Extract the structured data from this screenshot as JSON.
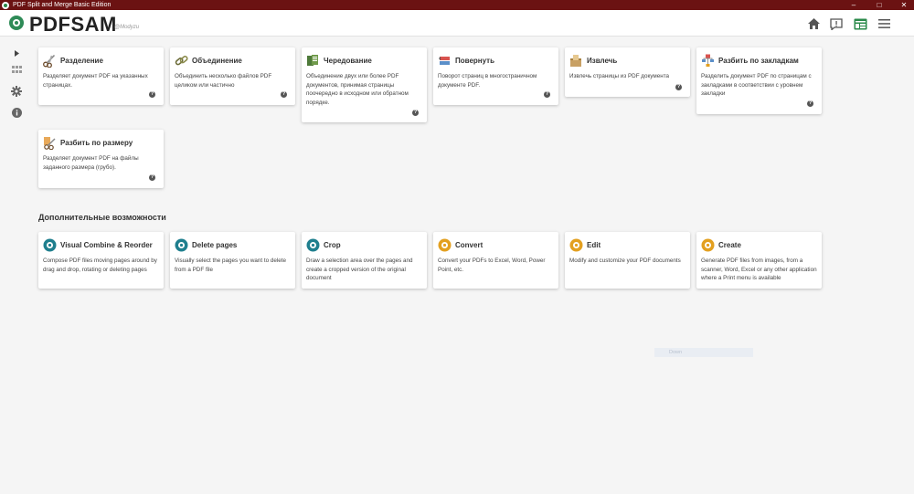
{
  "window": {
    "title": "PDF Split and Merge Basic Edition",
    "minimize": "–",
    "maximize": "□",
    "close": "✕"
  },
  "header": {
    "logo": "PDFSAM",
    "sublogo": "@Modyzu"
  },
  "tools": [
    {
      "title": "Разделение",
      "desc": "Разделяет документ PDF на указанных страницах.",
      "help": "?"
    },
    {
      "title": "Объединение",
      "desc": "Объединить несколько файлов PDF целиком или частично",
      "help": "?"
    },
    {
      "title": "Чередование",
      "desc": "Объединение двух или более PDF документов, принимая страницы поочередно в исходном или обратном порядке.",
      "help": "?"
    },
    {
      "title": "Повернуть",
      "desc": "Поворот страниц в многостраничном документе PDF.",
      "help": "?"
    },
    {
      "title": "Извлечь",
      "desc": "Извлечь страницы из PDF документа",
      "help": "?"
    },
    {
      "title": "Разбить по закладкам",
      "desc": "Разделить документ PDF по страницам с закладками в соответствии с уровнем закладки",
      "help": "?"
    },
    {
      "title": "Разбить по размеру",
      "desc": "Разделяет документ PDF на файлы заданного размера (грубо).",
      "help": "?"
    }
  ],
  "extras_title": "Дополнительные возможности",
  "extras": [
    {
      "title": "Visual Combine & Reorder",
      "desc": "Compose PDF files moving pages around by drag and drop, rotating or deleting pages"
    },
    {
      "title": "Delete pages",
      "desc": "Visually select the pages you want to delete from a PDF file"
    },
    {
      "title": "Crop",
      "desc": "Draw a selection area over the pages and create a cropped version of the original document"
    },
    {
      "title": "Convert",
      "desc": "Convert your PDFs to Excel, Word, Power Point, etc."
    },
    {
      "title": "Edit",
      "desc": "Modify and customize your PDF documents"
    },
    {
      "title": "Create",
      "desc": "Generate PDF files from images, from a scanner, Word, Excel or any other application where a Print menu is available"
    }
  ],
  "ghost_label": "Down",
  "colors": {
    "titlebar": "#6b1212",
    "brand_green": "#2e8b57",
    "teal_icon": "#1f7f8e",
    "orange_icon": "#e3a020"
  }
}
